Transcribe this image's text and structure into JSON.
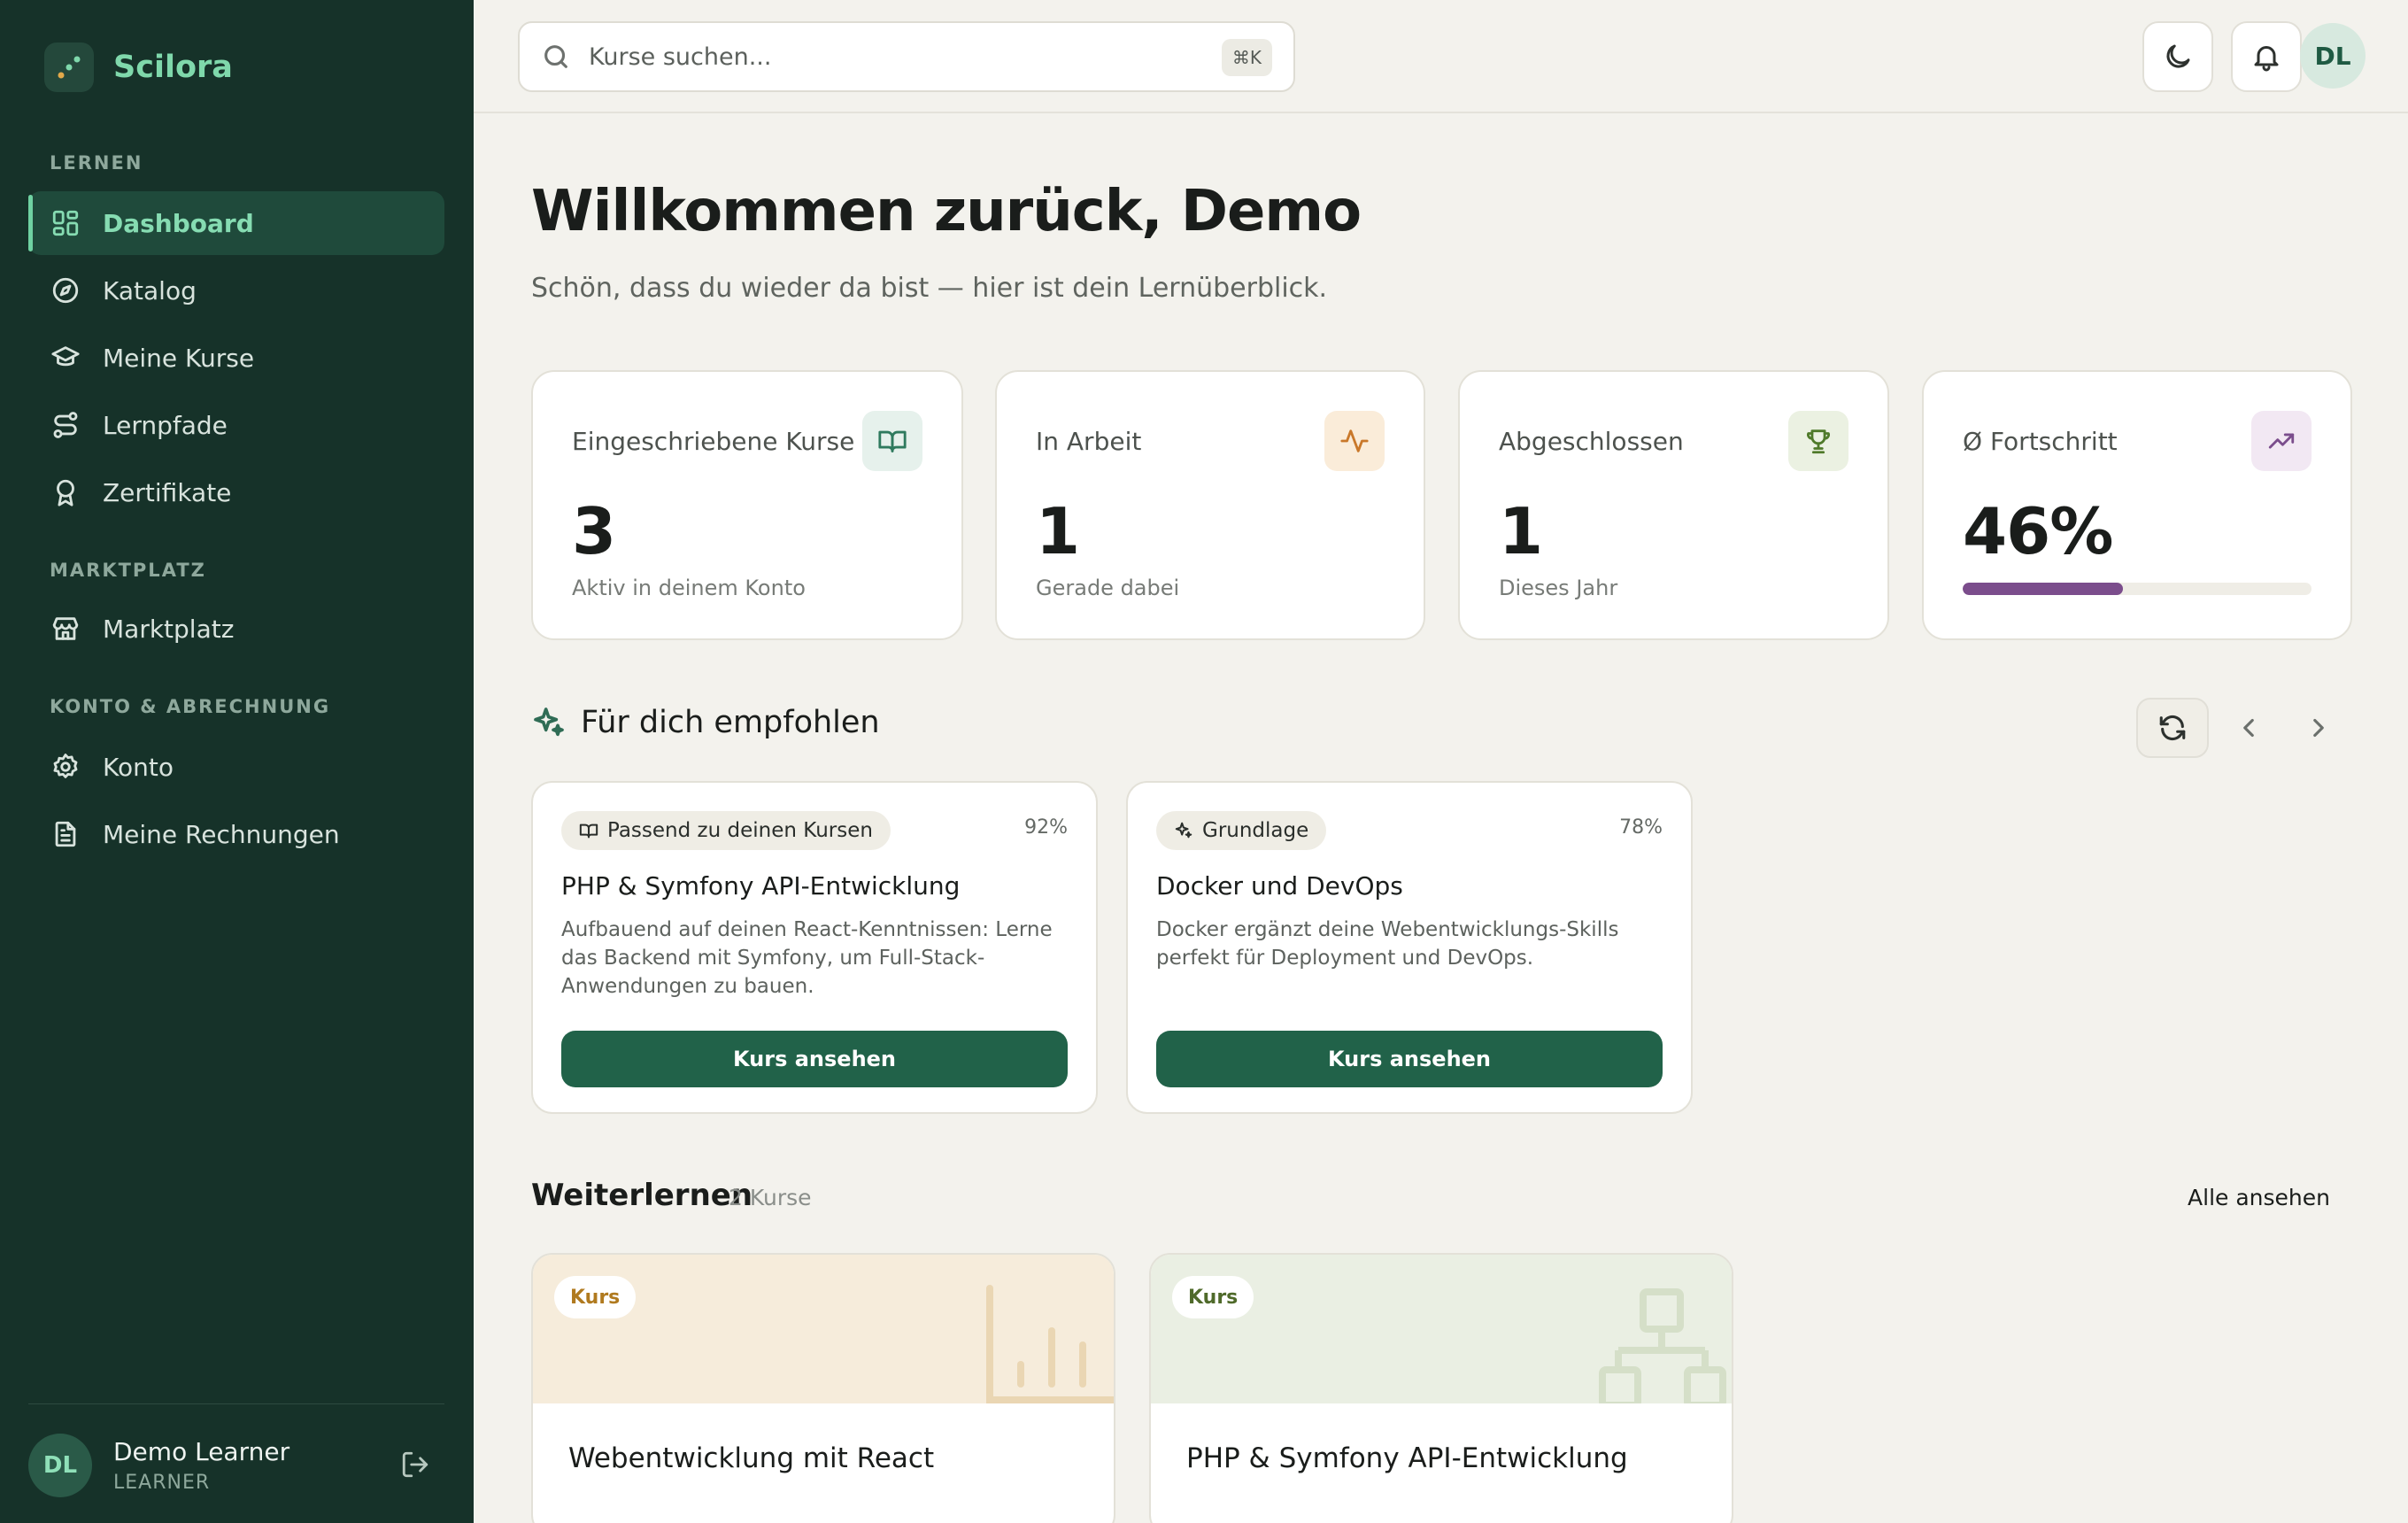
{
  "brand": {
    "name": "Scilora"
  },
  "sidebar": {
    "sections": [
      "LERNEN",
      "MARKTPLATZ",
      "KONTO & ABRECHNUNG"
    ],
    "items": [
      {
        "label": "Dashboard",
        "icon": "dashboard-icon",
        "active": true
      },
      {
        "label": "Katalog",
        "icon": "compass-icon"
      },
      {
        "label": "Meine Kurse",
        "icon": "graduation-cap-icon"
      },
      {
        "label": "Lernpfade",
        "icon": "route-icon"
      },
      {
        "label": "Zertifikate",
        "icon": "award-icon"
      },
      {
        "label": "Marktplatz",
        "icon": "store-icon"
      },
      {
        "label": "Konto",
        "icon": "gear-icon"
      },
      {
        "label": "Meine Rechnungen",
        "icon": "invoice-icon"
      }
    ],
    "user": {
      "initials": "DL",
      "name": "Demo Learner",
      "role": "LEARNER"
    }
  },
  "topbar": {
    "search_placeholder": "Kurse suchen...",
    "shortcut": "⌘K",
    "avatar_initials": "DL"
  },
  "main": {
    "title": "Willkommen zurück, Demo",
    "subtitle": "Schön, dass du wieder da bist — hier ist dein Lernüberblick.",
    "stats": [
      {
        "label": "Eingeschriebene Kurse",
        "value": "3",
        "hint": "Aktiv in deinem Konto",
        "icon": "book-open-icon",
        "accent": "#2f7a5e"
      },
      {
        "label": "In Arbeit",
        "value": "1",
        "hint": "Gerade dabei",
        "icon": "activity-icon",
        "accent": "#c9782a"
      },
      {
        "label": "Abgeschlossen",
        "value": "1",
        "hint": "Dieses Jahr",
        "icon": "trophy-icon",
        "accent": "#4f7a2a"
      },
      {
        "label": "Ø Fortschritt",
        "value": "46%",
        "progress": 0.46,
        "icon": "trending-up-icon",
        "accent": "#7b4d8c"
      }
    ],
    "recommendations": {
      "title": "Für dich empfohlen",
      "cards": [
        {
          "badge": "Passend zu deinen Kursen",
          "score": "92%",
          "title": "PHP & Symfony API-Entwicklung",
          "description": "Aufbauend auf deinen React-Kenntnissen: Lerne das Backend mit Symfony, um Full-Stack-Anwendungen zu bauen.",
          "button": "Kurs ansehen"
        },
        {
          "badge": "Grundlage",
          "score": "78%",
          "title": "Docker und DevOps",
          "description": "Docker ergänzt deine Webentwicklungs-Skills perfekt für Deployment und DevOps.",
          "button": "Kurs ansehen"
        }
      ]
    },
    "continue": {
      "title": "Weiterlernen",
      "count": "2 Kurse",
      "view_all": "Alle ansehen",
      "courses": [
        {
          "tag": "Kurs",
          "title": "Webentwicklung mit React",
          "banner": "#f6ecdb",
          "tag_color": "#b07a1f"
        },
        {
          "tag": "Kurs",
          "title": "PHP & Symfony API-Entwicklung",
          "banner": "#eaefe3",
          "tag_color": "#4f6a2a"
        }
      ]
    }
  }
}
